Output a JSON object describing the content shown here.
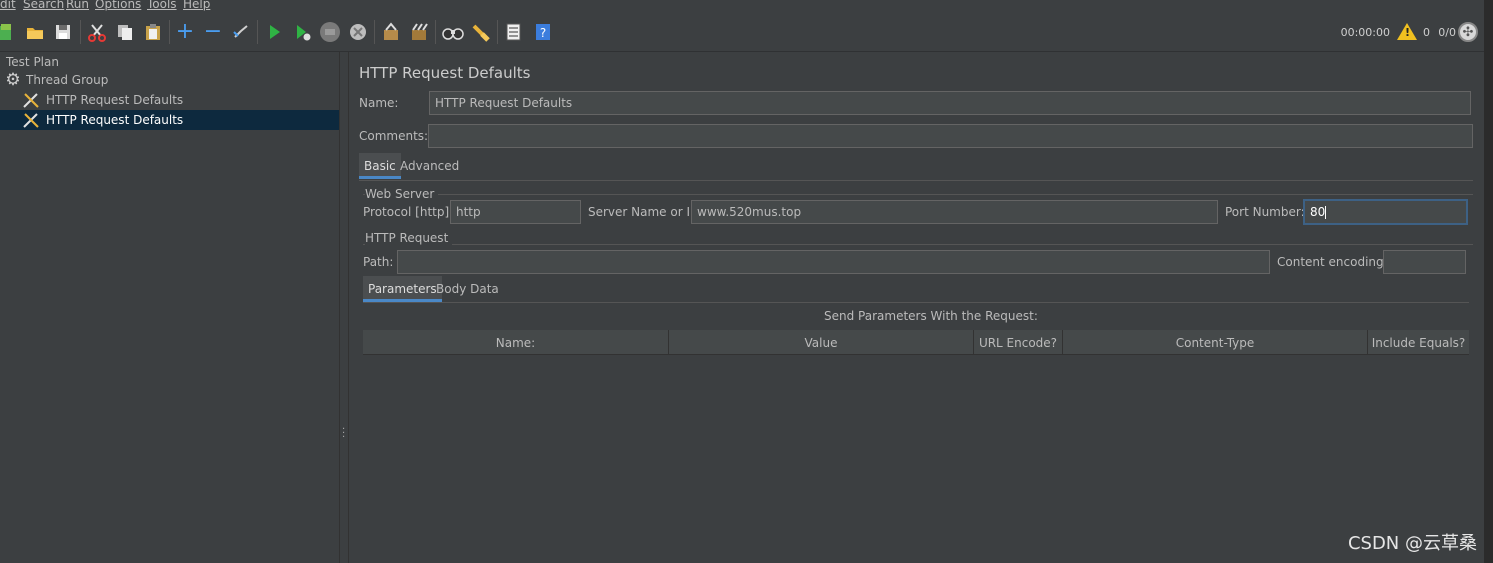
{
  "menu": [
    "dit",
    "Search",
    "Run",
    "Options",
    "Tools",
    "Help"
  ],
  "toolbar": {
    "timer": "00:00:00",
    "warning_count": "0",
    "thread_count": "0/0"
  },
  "tree": {
    "items": [
      {
        "label": "Test Plan"
      },
      {
        "label": "Thread Group"
      },
      {
        "label": "HTTP Request Defaults"
      },
      {
        "label": "HTTP Request Defaults"
      }
    ]
  },
  "panel": {
    "title": "HTTP Request Defaults",
    "name_label": "Name:",
    "name_value": "HTTP Request Defaults",
    "comments_label": "Comments:",
    "comments_value": "",
    "tabs": [
      "Basic",
      "Advanced"
    ],
    "web_server": {
      "title": "Web Server",
      "protocol_label": "Protocol [http]:",
      "protocol_value": "http",
      "server_label": "Server Name or IP:",
      "server_value": "www.520mus.top",
      "port_label": "Port Number:",
      "port_value": "80"
    },
    "http_request": {
      "title": "HTTP Request",
      "path_label": "Path:",
      "path_value": "",
      "encoding_label": "Content encoding:",
      "encoding_value": ""
    },
    "sub_tabs": [
      "Parameters",
      "Body Data"
    ],
    "params_caption": "Send Parameters With the Request:",
    "columns": [
      "Name:",
      "Value",
      "URL Encode?",
      "Content-Type",
      "Include Equals?"
    ]
  },
  "watermark": "CSDN @云草桑",
  "colors": {
    "background": "#3c3f41",
    "selection": "#0d293e",
    "tab_accent": "#4a88c7",
    "focus_border": "#3d6185"
  }
}
